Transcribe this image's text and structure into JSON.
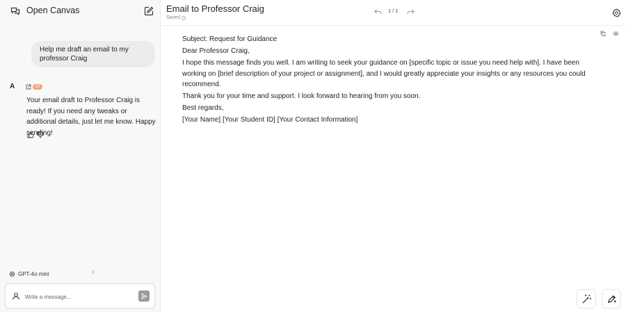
{
  "sidebar": {
    "brand_title": "Open Canvas",
    "icons": {
      "brand": "chat-bubbles-icon",
      "compose": "new-chat-icon"
    }
  },
  "chat": {
    "user_message": "Help me draft an email to my professor Craig",
    "assistant_avatar": "A",
    "version_badge": "v2",
    "assistant_message": "Your email draft to Professor Craig is ready! If you need any tweaks or additional details, just let me know. Happy sending!"
  },
  "model": {
    "label": "GPT-4o mini"
  },
  "composer": {
    "placeholder": "Write a message..."
  },
  "canvas": {
    "title": "Email to Professor Craig",
    "saved_label": "Saved",
    "page_indicator": "1 / 1",
    "document": {
      "subject": "Subject: Request for Guidance",
      "greeting": "Dear Professor Craig,",
      "paragraph1": "I hope this message finds you well. I am writing to seek your guidance on [specific topic or issue you need help with]. I have been working on [brief description of your project or assignment], and I would greatly appreciate your insights or any resources you could recommend.",
      "paragraph2": "Thank you for your time and support. I look forward to hearing from you soon.",
      "closing": "Best regards,",
      "signature": "[Your Name] [Your Student ID] [Your Contact Information]"
    }
  },
  "colors": {
    "sidebar_bg": "#f8f8f8",
    "badge": "#f2a37c",
    "send_button": "#9a9a9a"
  }
}
